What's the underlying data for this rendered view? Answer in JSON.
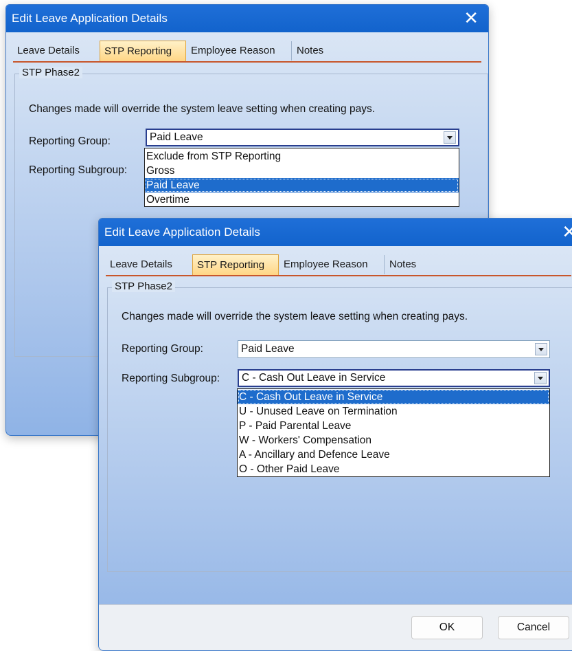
{
  "dialog": {
    "title": "Edit Leave Application Details",
    "tabs": [
      "Leave Details",
      "STP Reporting",
      "Employee Reason",
      "Notes"
    ],
    "active_tab": "STP Reporting",
    "group_label": "STP Phase2",
    "info_text": "Changes made will override the system leave setting when creating pays.",
    "reporting_group_label": "Reporting Group:",
    "reporting_subgroup_label": "Reporting Subgroup:",
    "ok_label": "OK",
    "cancel_label": "Cancel",
    "close_glyph": "✕"
  },
  "back_window": {
    "reporting_group_value": "Paid Leave",
    "reporting_group_options": [
      "Exclude from STP Reporting",
      "Gross",
      "Paid Leave",
      "Overtime"
    ],
    "selected_option": "Paid Leave"
  },
  "front_window": {
    "reporting_group_value": "Paid Leave",
    "reporting_subgroup_value": "C - Cash Out Leave in Service",
    "reporting_subgroup_options": [
      "C - Cash Out Leave in Service",
      "U - Unused Leave on Termination",
      "P - Paid Parental Leave",
      "W - Workers' Compensation",
      "A - Ancillary and Defence Leave",
      "O - Other Paid Leave"
    ],
    "selected_option": "C - Cash Out Leave in Service"
  },
  "colors": {
    "titlebar": "#1263cc",
    "active_tab": "#ffd583",
    "selection": "#1e6ccc",
    "tab_underline": "#c8562b"
  }
}
